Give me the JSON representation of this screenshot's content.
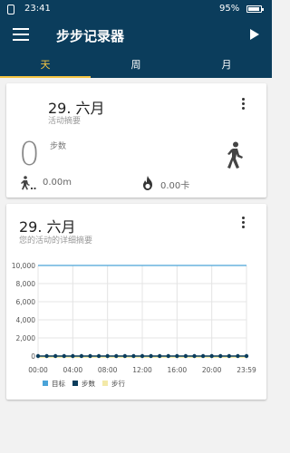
{
  "status_bar": {
    "time": "23:41",
    "battery": "95%"
  },
  "app_bar": {
    "title": "步步记录器"
  },
  "tabs": [
    {
      "label": "天",
      "active": true
    },
    {
      "label": "周",
      "active": false
    },
    {
      "label": "月",
      "active": false
    }
  ],
  "summary_card": {
    "date": "29. 六月",
    "subtitle": "活动摘要",
    "steps_value": "0",
    "steps_label": "步数",
    "distance": "0.00m",
    "calories": "0.00卡"
  },
  "detail_card": {
    "date": "29. 六月",
    "subtitle": "您的活动的详细摘要"
  },
  "colors": {
    "primary": "#0b3d5c",
    "accent": "#f5c542",
    "goal_line": "#4aa3d8",
    "steps": "#0b3d5c",
    "walking": "#f3e9a8"
  },
  "chart_data": {
    "type": "line",
    "x_ticks": [
      "00:00",
      "04:00",
      "08:00",
      "12:00",
      "16:00",
      "20:00",
      "23:59"
    ],
    "y_ticks": [
      "0",
      "2,000",
      "4,000",
      "6,000",
      "8,000",
      "10,000"
    ],
    "ylim": [
      0,
      10000
    ],
    "grid": true,
    "legend_position": "bottom-left",
    "series": [
      {
        "name": "目标",
        "type": "line",
        "values": [
          10000,
          10000
        ]
      },
      {
        "name": "步数",
        "type": "line",
        "values": [
          0,
          0,
          0,
          0,
          0,
          0,
          0,
          0,
          0,
          0,
          0,
          0,
          0,
          0,
          0,
          0,
          0,
          0,
          0,
          0,
          0,
          0,
          0,
          0,
          0
        ]
      },
      {
        "name": "步行",
        "type": "area",
        "values": [
          0,
          0,
          0,
          0,
          0,
          0,
          0,
          0,
          0,
          0,
          0,
          0,
          0,
          0,
          0,
          0,
          0,
          0,
          0,
          0,
          0,
          0,
          0,
          0,
          0
        ]
      }
    ]
  }
}
